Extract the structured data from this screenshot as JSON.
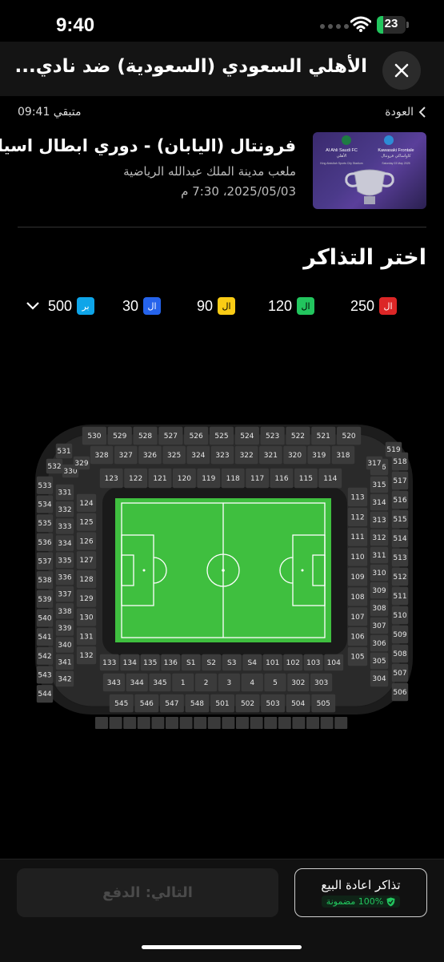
{
  "status_bar": {
    "time": "9:40",
    "battery": "23",
    "battery_level": 0.23
  },
  "header": {
    "title": "الأهلي السعودي (السعودية) ضد نادي..."
  },
  "event": {
    "back_label": "العودة",
    "remaining": "متبقي 09:41",
    "title": "فرونتال (اليابان) - دوري ابطال اسيا...",
    "venue": "ملعب مدينة الملك عبدالله الرياضية",
    "datetime": "2025/05/03، 7:30 م",
    "poster": {
      "team_left": "Al Ahli Saudi FC",
      "team_left_ar": "الأهلي",
      "team_right": "Kawasaki Frontale",
      "team_right_ar": "كاواساكي فرونتال",
      "venue": "King Abdullah Sports City Stadium",
      "date": "Saturday 03 May 2025"
    }
  },
  "tickets": {
    "heading": "اختر التذاكر",
    "legend": [
      {
        "price": "250",
        "badge": "ال",
        "color": "#dc2626"
      },
      {
        "price": "120",
        "badge": "ال",
        "color": "#22c55e"
      },
      {
        "price": "90",
        "badge": "ال",
        "color": "#facc15"
      },
      {
        "price": "30",
        "badge": "ال",
        "color": "#2563eb"
      },
      {
        "price": "500",
        "badge": "بر",
        "color": "#0ea5e9"
      }
    ]
  },
  "stadium": {
    "top_rows": {
      "outer": [
        "530",
        "529",
        "528",
        "527",
        "526",
        "525",
        "524",
        "523",
        "522",
        "521",
        "520"
      ],
      "inner": [
        "328",
        "327",
        "326",
        "325",
        "324",
        "323",
        "322",
        "321",
        "320",
        "319",
        "318"
      ],
      "lower": [
        "123",
        "122",
        "121",
        "120",
        "119",
        "118",
        "117",
        "116",
        "115",
        "114"
      ]
    },
    "bottom_rows": {
      "lower": [
        "133",
        "134",
        "135",
        "136",
        "S1",
        "S2",
        "S3",
        "S4",
        "101",
        "102",
        "103",
        "104"
      ],
      "mid": [
        "343",
        "344",
        "345",
        "1",
        "2",
        "3",
        "4",
        "5",
        "302",
        "303"
      ],
      "outer": [
        "545",
        "546",
        "547",
        "548",
        "501",
        "502",
        "503",
        "504",
        "505"
      ]
    },
    "left_cols": {
      "outer": [
        "533",
        "534",
        "535",
        "536",
        "537",
        "538",
        "539",
        "540",
        "541",
        "542",
        "543",
        "544"
      ],
      "mid": [
        "331",
        "332",
        "333",
        "334",
        "335",
        "336",
        "337",
        "338",
        "339",
        "340",
        "341",
        "342"
      ],
      "inner": [
        "124",
        "125",
        "126",
        "127",
        "128",
        "129",
        "130",
        "131",
        "132"
      ]
    },
    "right_cols": {
      "inner": [
        "113",
        "112",
        "111",
        "110",
        "109",
        "108",
        "107",
        "106",
        "105"
      ],
      "mid": [
        "316",
        "315",
        "314",
        "313",
        "312",
        "311",
        "310",
        "309",
        "308",
        "307",
        "306",
        "305",
        "304"
      ],
      "outer": [
        "518",
        "517",
        "516",
        "515",
        "514",
        "513",
        "512",
        "511",
        "510",
        "509",
        "508",
        "507",
        "506"
      ]
    },
    "corner_left": [
      "532",
      "531",
      "330",
      "329"
    ],
    "corner_right": [
      "519",
      "317"
    ]
  },
  "footer": {
    "next_label": "التالي: الدفع",
    "resale_title": "تذاكر اعادة البيع",
    "resale_badge": "100% مضمونة"
  }
}
